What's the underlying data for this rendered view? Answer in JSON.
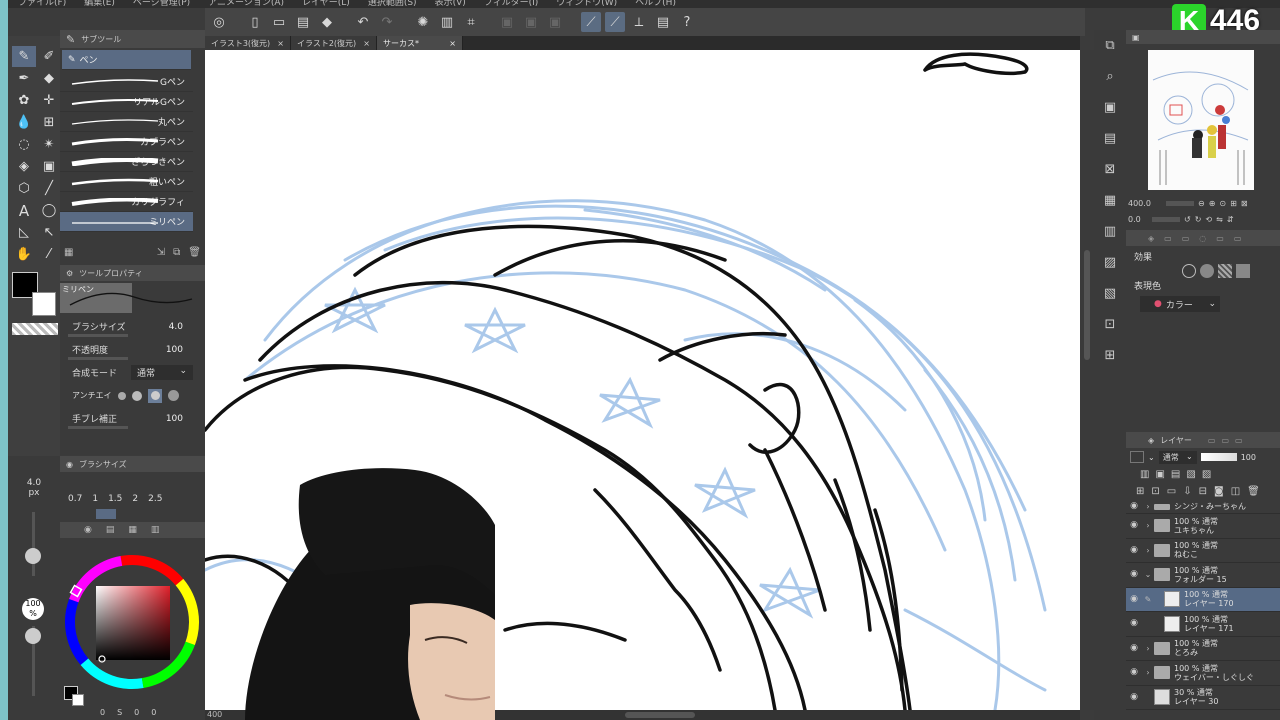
{
  "menu": [
    "ファイル(F)",
    "編集(E)",
    "ページ管理(P)",
    "アニメーション(A)",
    "レイヤー(L)",
    "選択範囲(S)",
    "表示(V)",
    "フィルター(I)",
    "ウィンドウ(W)",
    "ヘルプ(H)"
  ],
  "tabs": [
    {
      "label": "イラスト3(復元)",
      "close": "×"
    },
    {
      "label": "イラスト2(復元)",
      "close": "×"
    },
    {
      "label": "サーカス*",
      "close": "×"
    }
  ],
  "subtool": {
    "header": "サブツール",
    "current": "ペン",
    "items": [
      "Gペン",
      "リアルGペン",
      "丸ペン",
      "カブラペン",
      "ざらつきペン",
      "粗いペン",
      "カリグラフィ",
      "ミリペン"
    ]
  },
  "tool_property": {
    "header": "ツールプロパティ",
    "preview_label": "ミリペン",
    "brush_size_label": "ブラシサイズ",
    "brush_size": "4.0",
    "opacity_label": "不透明度",
    "opacity": "100",
    "blend_label": "合成モード",
    "blend": "通常",
    "antialias_label": "アンチエイリアス",
    "stabilize_label": "手ブレ補正",
    "stabilize": "100"
  },
  "brush_size_panel": {
    "header": "ブラシサイズ",
    "current": "4.0",
    "unit": "px",
    "sizes": [
      "0.7",
      "1",
      "1.5",
      "2",
      "2.5"
    ],
    "opacity_badge": "100",
    "opacity_unit": "%"
  },
  "color_panel": {
    "bottom_values": [
      "0",
      "S",
      "0",
      "0"
    ]
  },
  "navigator": {
    "zoom": "400.0",
    "angle": "0.0"
  },
  "effects": {
    "header": "効果",
    "color_expression_label": "表現色",
    "color_expression": "カラー"
  },
  "layers_panel": {
    "header": "レイヤー",
    "blend": "通常",
    "opacity": "100",
    "rows": [
      {
        "name": "シンジ・みーちゃん",
        "mode": "",
        "type": "folder",
        "selected": false
      },
      {
        "name": "ユキちゃん",
        "mode": "100 % 通常",
        "type": "folder",
        "selected": false
      },
      {
        "name": "ねむこ",
        "mode": "100 % 通常",
        "type": "folder",
        "selected": false
      },
      {
        "name": "フォルダー 15",
        "mode": "100 % 通常",
        "type": "folder",
        "selected": false
      },
      {
        "name": "レイヤー 170",
        "mode": "100 % 通常",
        "type": "layer",
        "selected": true
      },
      {
        "name": "レイヤー 171",
        "mode": "100 % 通常",
        "type": "layer",
        "selected": false
      },
      {
        "name": "とろみ",
        "mode": "100 % 通常",
        "type": "folder",
        "selected": false
      },
      {
        "name": "ウェイバー・しぐしぐ",
        "mode": "100 % 通常",
        "type": "folder",
        "selected": false
      },
      {
        "name": "レイヤー 30",
        "mode": "30 % 通常",
        "type": "layer",
        "selected": false
      }
    ]
  },
  "stream_logo": {
    "letter": "K",
    "number": "446"
  },
  "status": {
    "zoom": "400"
  },
  "colors": {
    "accent": "#5a6b84",
    "brand": "#2bd42b"
  }
}
